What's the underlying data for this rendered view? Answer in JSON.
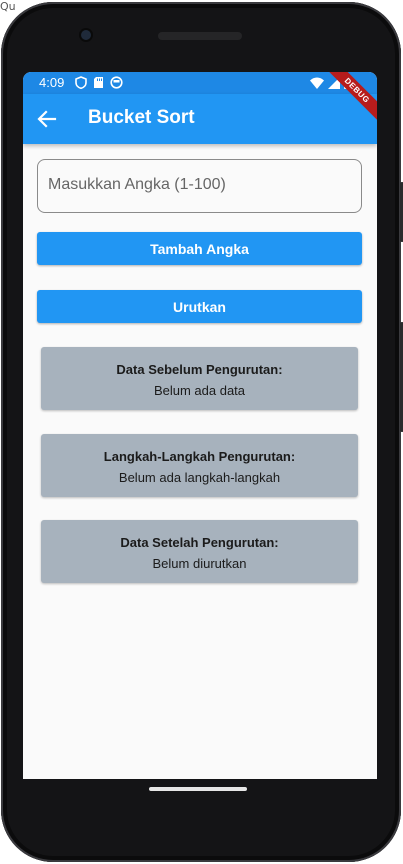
{
  "corner_text": "Qu",
  "status_bar": {
    "time": "4:09",
    "icons_left": [
      "shield-icon",
      "sd-card-icon",
      "circle-icon"
    ],
    "icons_right": [
      "wifi-icon",
      "signal-icon",
      "battery-icon"
    ]
  },
  "app_bar": {
    "title": "Bucket Sort",
    "debug_label": "DEBUG"
  },
  "input": {
    "placeholder": "Masukkan Angka (1-100)",
    "value": ""
  },
  "buttons": {
    "add": "Tambah Angka",
    "sort": "Urutkan"
  },
  "cards": [
    {
      "title": "Data Sebelum Pengurutan:",
      "text": "Belum ada data"
    },
    {
      "title": "Langkah-Langkah Pengurutan:",
      "text": "Belum ada langkah-langkah"
    },
    {
      "title": "Data Setelah Pengurutan:",
      "text": "Belum diurutkan"
    }
  ],
  "colors": {
    "primary": "#2196f3",
    "status_bar": "#1e88e5",
    "card_bg": "#a7b2bd",
    "debug": "#b71c1c"
  }
}
